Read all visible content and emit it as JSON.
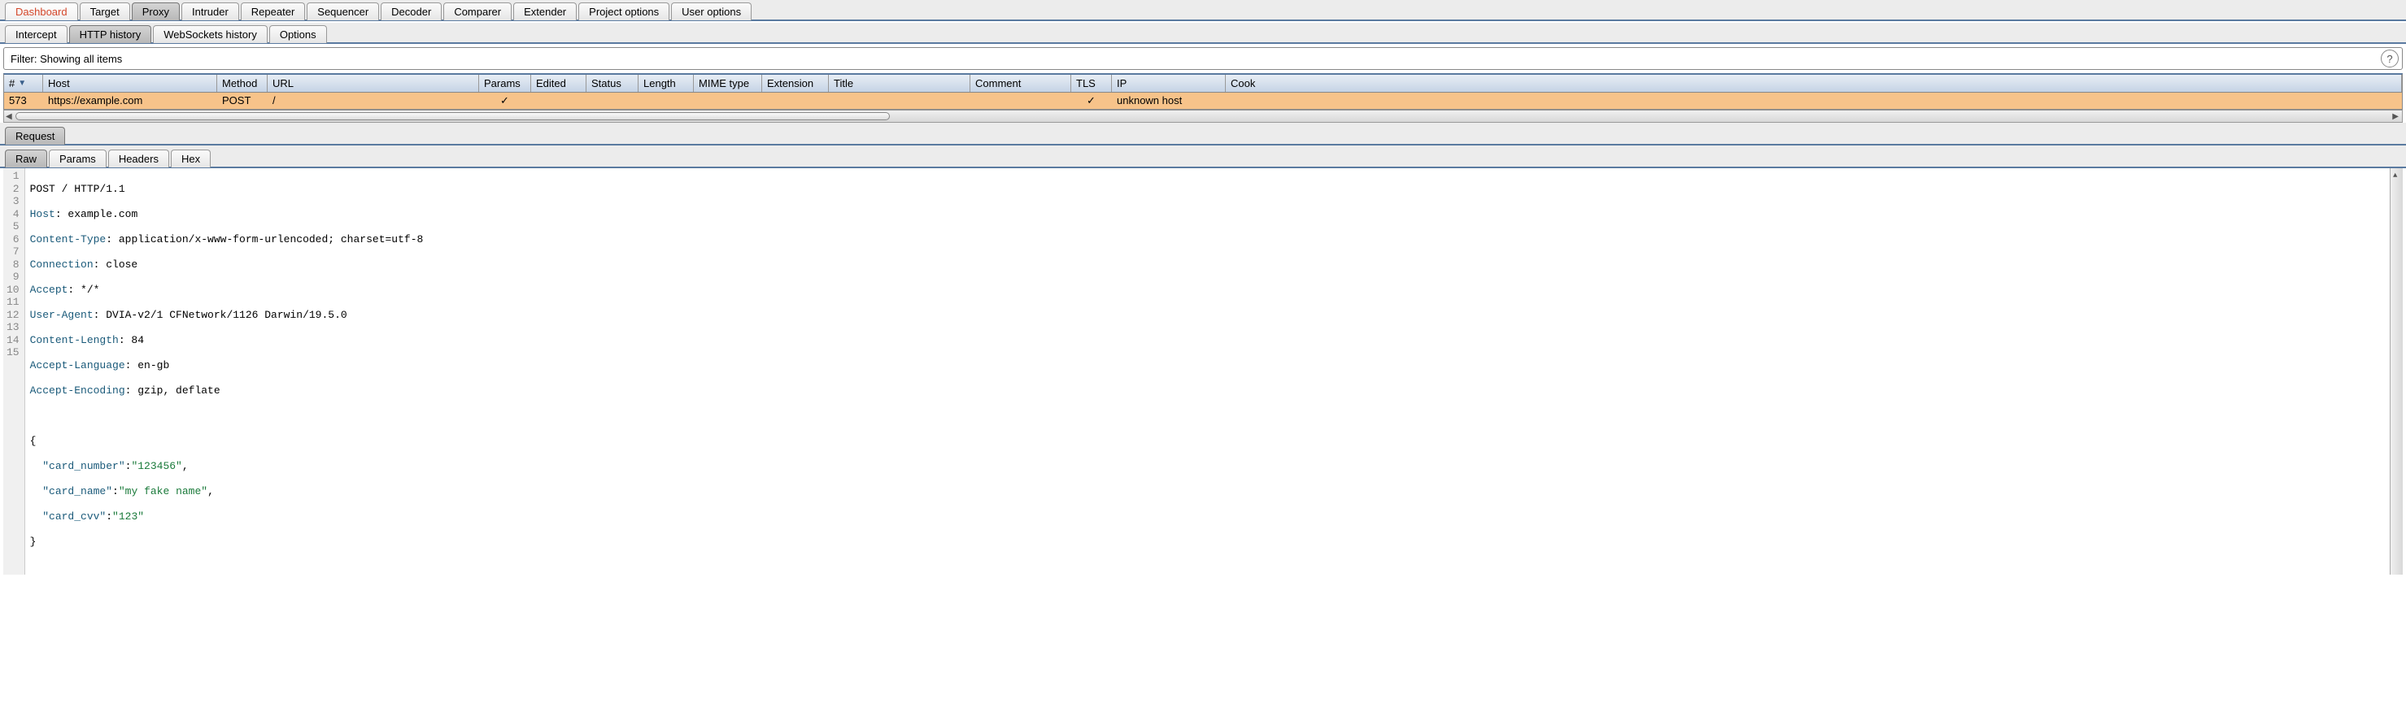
{
  "mainTabs": [
    "Dashboard",
    "Target",
    "Proxy",
    "Intruder",
    "Repeater",
    "Sequencer",
    "Decoder",
    "Comparer",
    "Extender",
    "Project options",
    "User options"
  ],
  "mainActiveDashboard": "Dashboard",
  "proxyTabs": [
    "Intercept",
    "HTTP history",
    "WebSockets history",
    "Options"
  ],
  "filter": "Filter: Showing all items",
  "cols": {
    "num": "#",
    "host": "Host",
    "method": "Method",
    "url": "URL",
    "params": "Params",
    "edited": "Edited",
    "status": "Status",
    "length": "Length",
    "mime": "MIME type",
    "ext": "Extension",
    "title": "Title",
    "comment": "Comment",
    "tls": "TLS",
    "ip": "IP",
    "cook": "Cook"
  },
  "row": {
    "num": "573",
    "host": "https://example.com",
    "method": "POST",
    "url": "/",
    "params": "✓",
    "edited": "",
    "status": "",
    "length": "",
    "mime": "",
    "ext": "",
    "title": "",
    "comment": "",
    "tls": "✓",
    "ip": "unknown host",
    "cook": ""
  },
  "reqTab": "Request",
  "viewTabs": [
    "Raw",
    "Params",
    "Headers",
    "Hex"
  ],
  "code": {
    "l1a": "POST / HTTP/1.1",
    "l2k": "Host",
    "l2v": ": example.com",
    "l3k": "Content-Type",
    "l3v": ": application/x-www-form-urlencoded; charset=utf-8",
    "l4k": "Connection",
    "l4v": ": close",
    "l5k": "Accept",
    "l5v": ": */*",
    "l6k": "User-Agent",
    "l6v": ": DVIA-v2/1 CFNetwork/1126 Darwin/19.5.0",
    "l7k": "Content-Length",
    "l7v": ": 84",
    "l8k": "Accept-Language",
    "l8v": ": en-gb",
    "l9k": "Accept-Encoding",
    "l9v": ": gzip, deflate",
    "l10": "",
    "l11": "{",
    "l12a": "  ",
    "l12k": "\"card_number\"",
    "l12c": ":",
    "l12v": "\"123456\"",
    "l12e": ",",
    "l13a": "  ",
    "l13k": "\"card_name\"",
    "l13c": ":",
    "l13v": "\"my fake name\"",
    "l13e": ",",
    "l14a": "  ",
    "l14k": "\"card_cvv\"",
    "l14c": ":",
    "l14v": "\"123\"",
    "l15": "}"
  },
  "lineNums": [
    "1",
    "2",
    "3",
    "4",
    "5",
    "6",
    "7",
    "8",
    "9",
    "10",
    "11",
    "12",
    "13",
    "14",
    "15"
  ],
  "help": "?"
}
